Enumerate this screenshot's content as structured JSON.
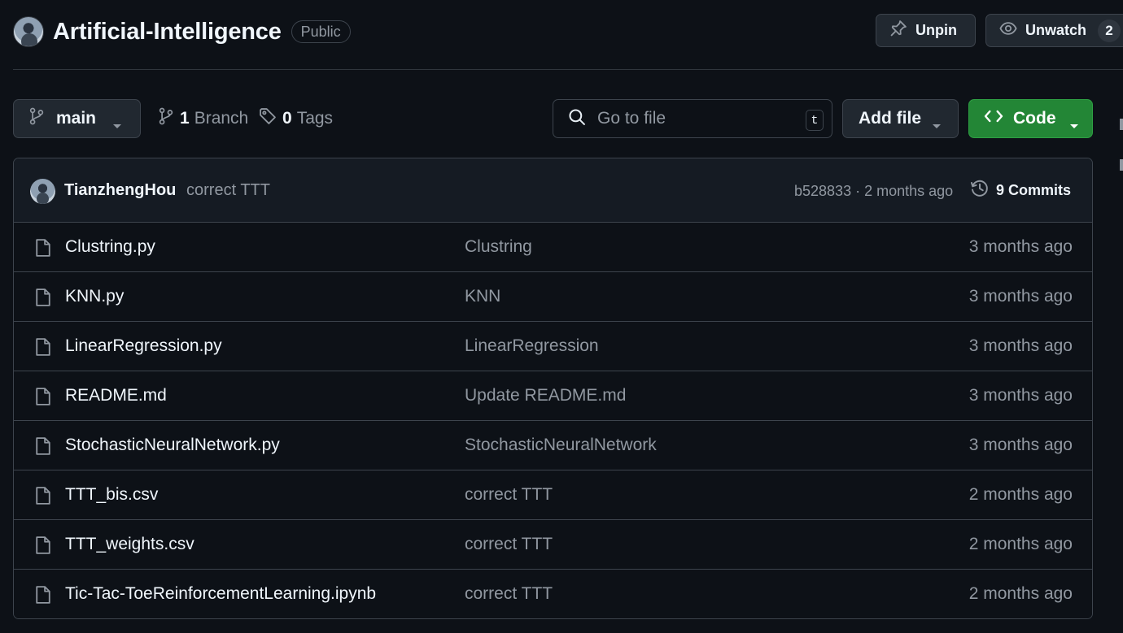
{
  "repo": {
    "name": "Artificial-Intelligence",
    "visibility": "Public",
    "unpin_label": "Unpin",
    "unwatch_label": "Unwatch",
    "watch_count": "2"
  },
  "toolbar": {
    "branch": "main",
    "branch_count": "1",
    "branch_label": "Branch",
    "tag_count": "0",
    "tag_label": "Tags",
    "search_placeholder": "Go to file",
    "search_shortcut": "t",
    "add_file_label": "Add file",
    "code_label": "Code"
  },
  "commit": {
    "author": "TianzhengHou",
    "message": "correct TTT",
    "meta": "b528833 · 2 months ago",
    "commits_label": "9 Commits"
  },
  "files": [
    {
      "name": "Clustring.py",
      "message": "Clustring",
      "date": "3 months ago"
    },
    {
      "name": "KNN.py",
      "message": "KNN",
      "date": "3 months ago"
    },
    {
      "name": "LinearRegression.py",
      "message": "LinearRegression",
      "date": "3 months ago"
    },
    {
      "name": "README.md",
      "message": "Update README.md",
      "date": "3 months ago"
    },
    {
      "name": "StochasticNeuralNetwork.py",
      "message": "StochasticNeuralNetwork",
      "date": "3 months ago"
    },
    {
      "name": "TTT_bis.csv",
      "message": "correct TTT",
      "date": "2 months ago"
    },
    {
      "name": "TTT_weights.csv",
      "message": "correct TTT",
      "date": "2 months ago"
    },
    {
      "name": "Tic-Tac-ToeReinforcementLearning.ipynb",
      "message": "correct TTT",
      "date": "2 months ago"
    }
  ],
  "colors": {
    "background": "#0d1117",
    "border": "#3d444d",
    "code_button": "#238636",
    "muted_text": "#9198a1"
  },
  "icons": {
    "branch": "git-branch-icon",
    "tag": "tag-icon",
    "search": "search-icon",
    "pin": "pin-icon",
    "eye": "eye-icon",
    "code": "code-icon",
    "history": "history-icon",
    "file": "file-icon",
    "caret": "triangle-down-icon"
  }
}
